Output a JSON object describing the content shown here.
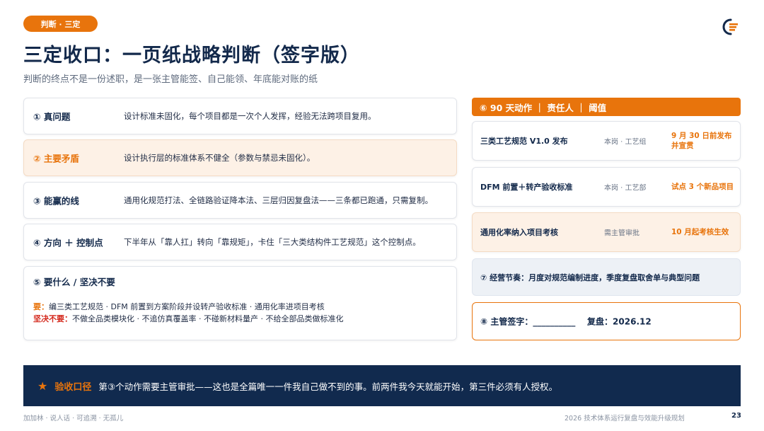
{
  "header": {
    "tag": "判断 · 三定",
    "title": "三定收口：一页纸战略判断（签字版）",
    "subtitle": "判断的终点不是一份述职，是一张主管能签、自己能领、年底能对账的纸"
  },
  "left_cards": [
    {
      "label": "① 真问题",
      "text": "设计标准未固化，每个项目都是一次个人发挥，经验无法跨项目复用。"
    },
    {
      "label": "② 主要矛盾",
      "text": "设计执行层的标准体系不健全（参数与禁忌未固化）。"
    },
    {
      "label": "③ 能赢的线",
      "text": "通用化规范打法、全链路验证降本法、三层归因复盘法——三条都已跑通，只需复制。"
    },
    {
      "label": "④ 方向 ＋ 控制点",
      "text": "下半年从「靠人扛」转向「靠规矩」，卡住「三大类结构件工艺规范」这个控制点。"
    }
  ],
  "card5": {
    "heading": "⑤ 要什么 / 坚决不要",
    "want_key": "要：",
    "want_text": "编三类工艺规范 · DFM 前置到方案阶段并设转产验收标准 · 通用化率进项目考核",
    "reject_key": "坚决不要：",
    "reject_text": "不做全品类模块化 · 不追仿真覆盖率 · 不碰新材料量产 · 不给全部品类做标准化"
  },
  "right": {
    "header": "⑥ 90 天动作 ｜ 责任人 ｜ 阈值",
    "actions": [
      {
        "action": "三类工艺规范 V1.0 发布",
        "owner": "本岗 · 工艺组",
        "threshold": "9 月 30 日前发布并宣贯"
      },
      {
        "action": "DFM 前置＋转产验收标准",
        "owner": "本岗 · 工艺部",
        "threshold": "试点 3 个新品项目"
      },
      {
        "action": "通用化率纳入项目考核",
        "owner": "需主管审批",
        "threshold": "10 月起考核生效"
      }
    ],
    "rhythm": "⑦ 经营节奏：月度对规范编制进度，季度复盘取舍单与典型问题",
    "sign": "⑧ 主管签字：__________    复盘：2026.12"
  },
  "banner": {
    "icon": "star-icon",
    "key": "验收口径",
    "text": "第③个动作需要主管审批——这也是全篇唯一一件我自己做不到的事。前两件我今天就能开始，第三件必须有人授权。"
  },
  "footer": {
    "left": "加加林 · 说人话 · 可追溯 · 无孤儿",
    "right": "2026 技术体系运行复盘与效能升级规划",
    "page": "23"
  },
  "colors": {
    "accent": "#e8740c",
    "navy": "#13294b",
    "banner_bg": "#112a4e",
    "highlight_bg": "#fdf1e6",
    "rhythm_bg": "#edf1f6",
    "reject_red": "#d4281c"
  }
}
